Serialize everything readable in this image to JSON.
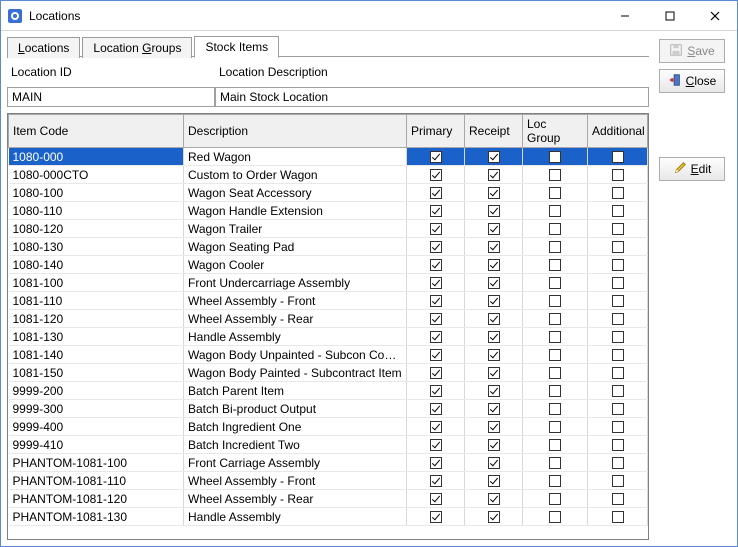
{
  "window": {
    "title": "Locations"
  },
  "tabs": {
    "locations": "Locations",
    "groups": "Location Groups",
    "stock": "Stock Items"
  },
  "location": {
    "id_label": "Location ID",
    "desc_label": "Location Description",
    "id_value": "MAIN",
    "desc_value": "Main Stock Location"
  },
  "buttons": {
    "save": "Save",
    "close": "Close",
    "edit": "Edit"
  },
  "columns": {
    "code": "Item Code",
    "desc": "Description",
    "primary": "Primary",
    "receipt": "Receipt",
    "locgroup": "Loc Group",
    "additional": "Additional"
  },
  "rows": [
    {
      "code": "1080-000",
      "desc": "Red Wagon",
      "primary": true,
      "receipt": true,
      "locgroup": false,
      "additional": false,
      "selected": true
    },
    {
      "code": "1080-000CTO",
      "desc": "Custom to Order Wagon",
      "primary": true,
      "receipt": true,
      "locgroup": false,
      "additional": false
    },
    {
      "code": "1080-100",
      "desc": "Wagon Seat Accessory",
      "primary": true,
      "receipt": true,
      "locgroup": false,
      "additional": false
    },
    {
      "code": "1080-110",
      "desc": "Wagon Handle Extension",
      "primary": true,
      "receipt": true,
      "locgroup": false,
      "additional": false
    },
    {
      "code": "1080-120",
      "desc": "Wagon Trailer",
      "primary": true,
      "receipt": true,
      "locgroup": false,
      "additional": false
    },
    {
      "code": "1080-130",
      "desc": "Wagon Seating Pad",
      "primary": true,
      "receipt": true,
      "locgroup": false,
      "additional": false
    },
    {
      "code": "1080-140",
      "desc": "Wagon Cooler",
      "primary": true,
      "receipt": true,
      "locgroup": false,
      "additional": false
    },
    {
      "code": "1081-100",
      "desc": "Front Undercarriage Assembly",
      "primary": true,
      "receipt": true,
      "locgroup": false,
      "additional": false
    },
    {
      "code": "1081-110",
      "desc": "Wheel Assembly - Front",
      "primary": true,
      "receipt": true,
      "locgroup": false,
      "additional": false
    },
    {
      "code": "1081-120",
      "desc": "Wheel Assembly - Rear",
      "primary": true,
      "receipt": true,
      "locgroup": false,
      "additional": false
    },
    {
      "code": "1081-130",
      "desc": "Handle Assembly",
      "primary": true,
      "receipt": true,
      "locgroup": false,
      "additional": false
    },
    {
      "code": "1081-140",
      "desc": "Wagon Body Unpainted - Subcon Component",
      "primary": true,
      "receipt": true,
      "locgroup": false,
      "additional": false
    },
    {
      "code": "1081-150",
      "desc": "Wagon Body Painted -  Subcontract Item",
      "primary": true,
      "receipt": true,
      "locgroup": false,
      "additional": false
    },
    {
      "code": "9999-200",
      "desc": "Batch Parent Item",
      "primary": true,
      "receipt": true,
      "locgroup": false,
      "additional": false
    },
    {
      "code": "9999-300",
      "desc": "Batch Bi-product Output",
      "primary": true,
      "receipt": true,
      "locgroup": false,
      "additional": false
    },
    {
      "code": "9999-400",
      "desc": "Batch Ingredient One",
      "primary": true,
      "receipt": true,
      "locgroup": false,
      "additional": false
    },
    {
      "code": "9999-410",
      "desc": "Batch Incredient Two",
      "primary": true,
      "receipt": true,
      "locgroup": false,
      "additional": false
    },
    {
      "code": "PHANTOM-1081-100",
      "desc": "Front Carriage Assembly",
      "primary": true,
      "receipt": true,
      "locgroup": false,
      "additional": false
    },
    {
      "code": "PHANTOM-1081-110",
      "desc": "Wheel Assembly - Front",
      "primary": true,
      "receipt": true,
      "locgroup": false,
      "additional": false
    },
    {
      "code": "PHANTOM-1081-120",
      "desc": "Wheel Assembly - Rear",
      "primary": true,
      "receipt": true,
      "locgroup": false,
      "additional": false
    },
    {
      "code": "PHANTOM-1081-130",
      "desc": "Handle Assembly",
      "primary": true,
      "receipt": true,
      "locgroup": false,
      "additional": false
    }
  ]
}
